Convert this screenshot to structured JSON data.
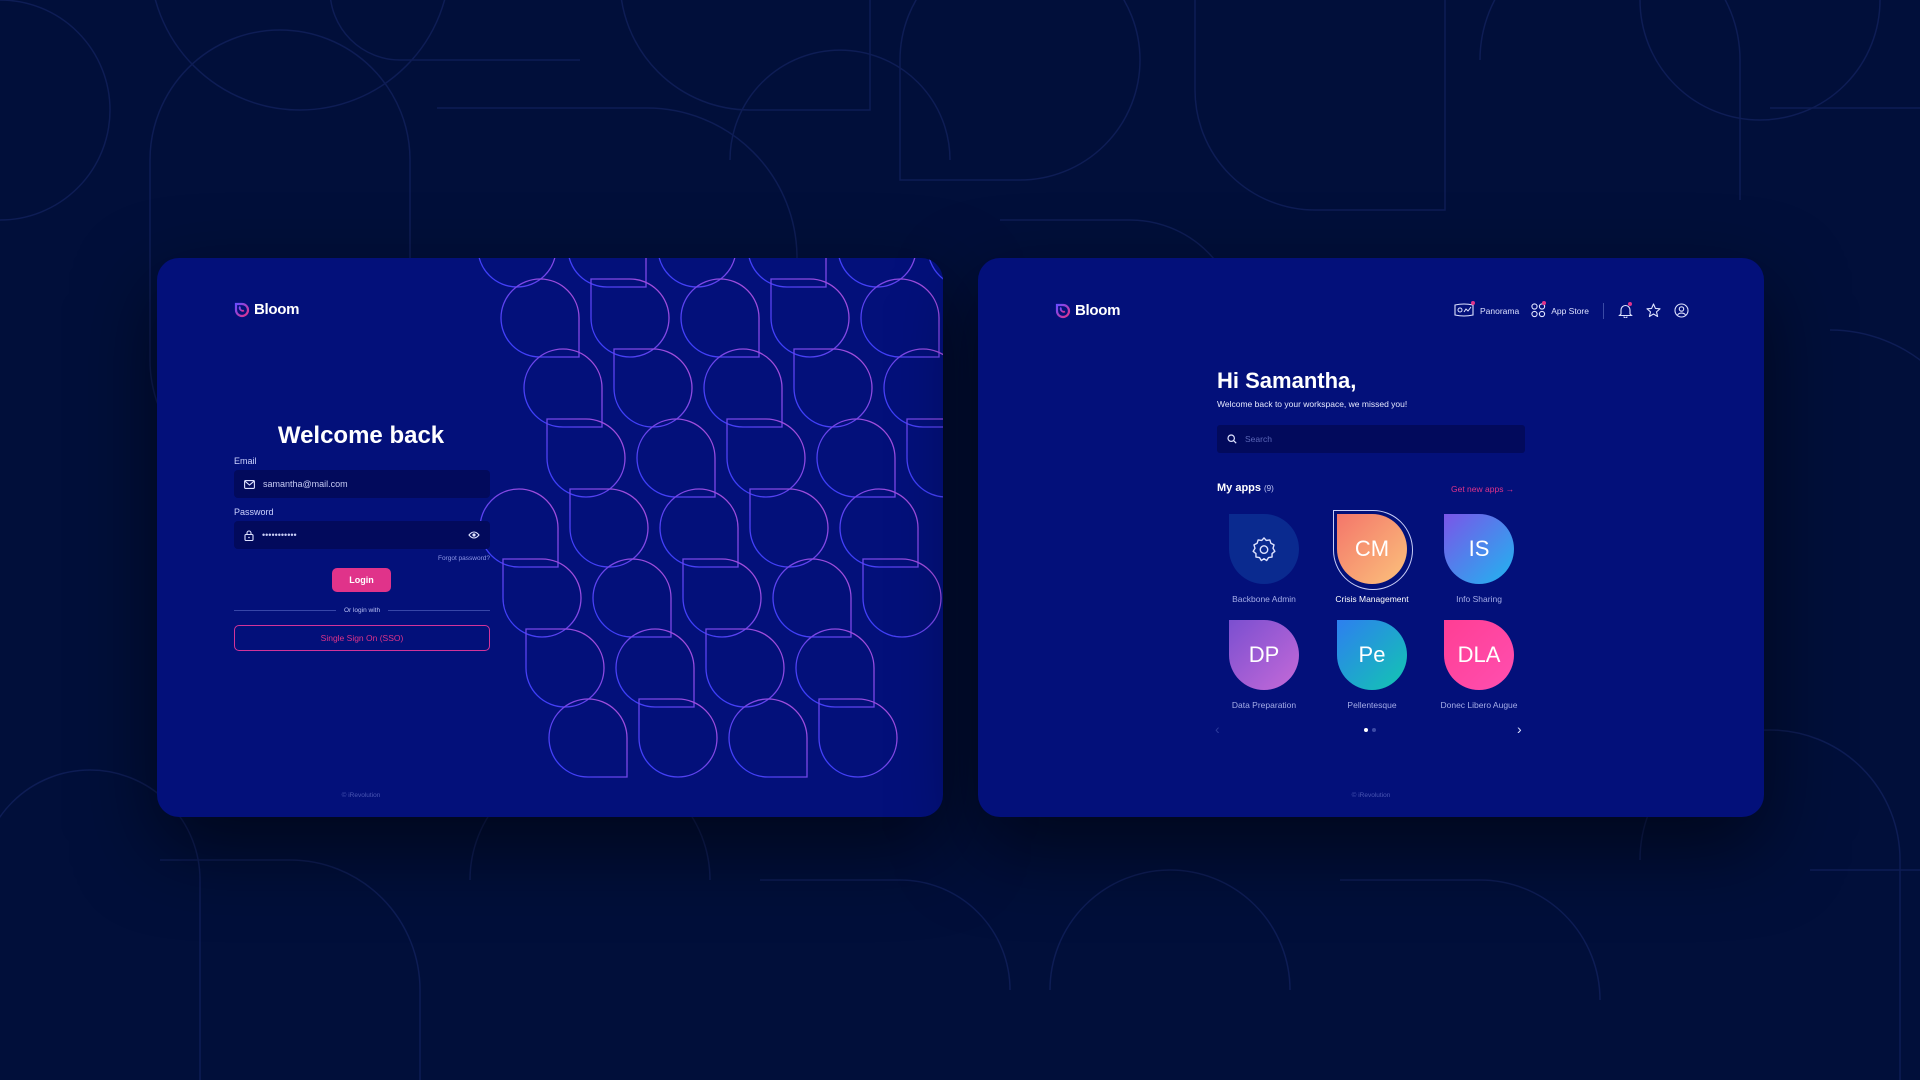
{
  "brand": {
    "name": "Bloom",
    "accent": "#e0338a",
    "card_bg": "#03107a",
    "page_bg": "#010f3a"
  },
  "login": {
    "title": "Welcome back",
    "email_label": "Email",
    "email_value": "samantha@mail.com",
    "password_label": "Password",
    "password_value": "•••••••••••",
    "forgot_password": "Forgot password?",
    "login_button": "Login",
    "divider_text": "Or login with",
    "sso_button": "Single Sign On (SSO)",
    "footer": "© iRevolution",
    "icons": {
      "email": "mail-icon",
      "password": "lock-icon",
      "toggle": "eye-icon"
    }
  },
  "home": {
    "nav": {
      "panorama": "Panorama",
      "app_store": "App Store",
      "icons": [
        "bell-icon",
        "star-icon",
        "user-icon"
      ]
    },
    "greeting": "Hi Samantha,",
    "subtitle": "Welcome back to your workspace, we missed you!",
    "search_placeholder": "Search",
    "apps_title": "My apps",
    "apps_count": "(9)",
    "get_new_apps": "Get new apps →",
    "apps": [
      {
        "initials": "",
        "icon": "gear-icon",
        "label": "Backbone Admin",
        "color_from": "#0a2a8f",
        "color_to": "#0a2a8f",
        "selected": false
      },
      {
        "initials": "CM",
        "label": "Crisis Management",
        "color_from": "#f4766a",
        "color_to": "#fbc27c",
        "selected": true
      },
      {
        "initials": "IS",
        "label": "Info Sharing",
        "color_from": "#7a55e8",
        "color_to": "#1fb6f0",
        "selected": false
      },
      {
        "initials": "DP",
        "label": "Data Preparation",
        "color_from": "#7b4fd0",
        "color_to": "#c56ad8",
        "selected": false
      },
      {
        "initials": "Pe",
        "label": "Pellentesque",
        "color_from": "#2d7ff0",
        "color_to": "#12c7b0",
        "selected": false
      },
      {
        "initials": "DLA",
        "label": "Donec Libero Augue",
        "color_from": "#ff3e94",
        "color_to": "#ff4fb0",
        "selected": false
      }
    ],
    "pager": {
      "current_page": 1,
      "total_pages": 2,
      "prev": "‹",
      "next": "›"
    },
    "footer": "© iRevolution"
  }
}
